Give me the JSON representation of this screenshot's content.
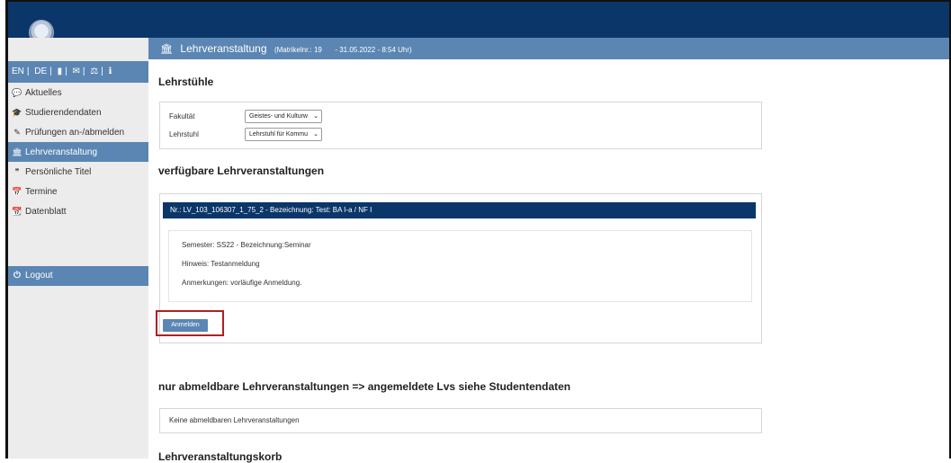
{
  "sidebar": {
    "lang_links": [
      "EN",
      "DE"
    ],
    "nav": [
      {
        "icon": "comment-icon",
        "glyph": "💬",
        "label": "Aktuelles"
      },
      {
        "icon": "graduation-cap-icon",
        "glyph": "🎓",
        "label": "Studierendendaten"
      },
      {
        "icon": "edit-icon",
        "glyph": "✎",
        "label": "Prüfungen an-/abmelden"
      },
      {
        "icon": "bank-icon",
        "glyph": "🏛",
        "label": "Lehrveranstaltung"
      },
      {
        "icon": "quote-icon",
        "glyph": "❞",
        "label": "Persönliche Titel"
      },
      {
        "icon": "calendar-icon",
        "glyph": "📅",
        "label": "Termine"
      },
      {
        "icon": "calendar-grid-icon",
        "glyph": "📆",
        "label": "Datenblatt"
      }
    ],
    "logout": "Logout"
  },
  "header": {
    "title": "Lehrveranstaltung",
    "matrikel": "(Matrikelnr.: 19",
    "date": "- 31.05.2022 - 8:54 Uhr)"
  },
  "lehrstuehle": {
    "heading": "Lehrstühle",
    "fakultaet_label": "Fakultät",
    "fakultaet_value": "Geistes- und Kulturw",
    "lehrstuhl_label": "Lehrstuhl",
    "lehrstuhl_value": "Lehrstuhl für Kommu"
  },
  "verfuegbar": {
    "heading": "verfügbare Lehrveranstaltungen",
    "course_header": "Nr.: LV_103_106307_1_75_2 - Bezeichnung: Test: BA I-a / NF I",
    "semester": "Semester: SS22 - Bezeichnung:Seminar",
    "hinweis": "Hinweis: Testanmeldung",
    "anmerkungen": "Anmerkungen: vorläufige Anmeldung.",
    "button": "Anmelden"
  },
  "abmeldbar": {
    "heading": "nur abmeldbare Lehrveranstaltungen => angemeldete Lvs siehe Studentendaten",
    "empty": "Keine abmeldbaren Lehrveranstaltungen"
  },
  "korb": {
    "heading": "Lehrveranstaltungskorb"
  },
  "colors": {
    "topbar": "#0b3669",
    "accent": "#5b86b3",
    "highlight": "#b02020"
  }
}
